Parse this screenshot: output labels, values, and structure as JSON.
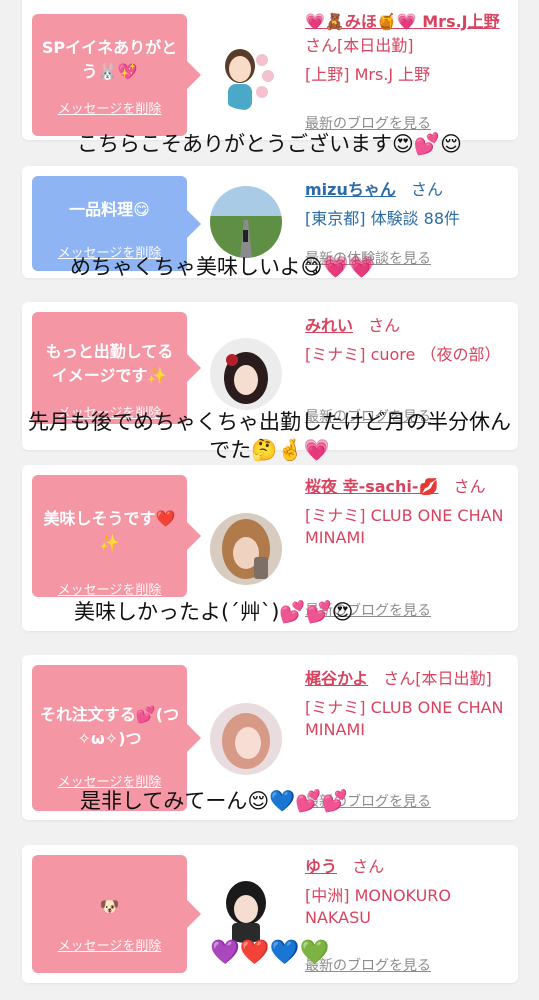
{
  "delete_label": "メッセージを削除",
  "blog_label": "最新のブログを見る",
  "cards": [
    {
      "message": "SPイイネありがとう🐰💖",
      "name": "💗🧸みほ🍯💗 Mrs.J上野",
      "san_suffix": "さん[本日出勤]",
      "shop": "[上野] Mrs.J 上野",
      "link": "最新のブログを見る",
      "overlay": "こちらこそありがとうございます😍💕😌"
    },
    {
      "message": "一品料理😋",
      "name": "mizuちゃん",
      "san_suffix": "さん",
      "shop": "[東京都] 体験談 88件",
      "link": "最新の体験談を見る",
      "overlay": "めちゃくちゃ美味しいよ😋💗💗"
    },
    {
      "message": "もっと出勤してるイメージです✨",
      "name": "みれい",
      "san_suffix": "さん",
      "shop": "[ミナミ] cuore （夜の部）",
      "link": "最新のブログを見る",
      "overlay": "先月も後でめちゃくちゃ出勤したけど月の半分休んでた🤔🤞💗"
    },
    {
      "message": "美味しそうです❤️✨",
      "name": "桜夜 幸-sachi-💋",
      "san_suffix": "さん",
      "shop": "[ミナミ] CLUB ONE CHAN MINAMI",
      "link": "最新のブログを見る",
      "overlay": "美味しかったよ(´艸`)💕💕😍"
    },
    {
      "message": "それ注文する💕(つ✧ω✧)つ",
      "name": "梶谷かよ",
      "san_suffix": "さん[本日出勤]",
      "shop": "[ミナミ] CLUB ONE CHAN MINAMI",
      "link": "最新のブログを見る",
      "overlay": "是非してみてーん😌💙💕💕"
    },
    {
      "message": "🐶",
      "name": "ゆう",
      "san_suffix": "さん",
      "shop": "[中洲] MONOKURO NAKASU",
      "link": "最新のブログを見る",
      "overlay": "💜❤️💙💚"
    }
  ],
  "colors": {
    "bubble_pink": "#f596a4",
    "bubble_blue": "#8eb4f3",
    "name_pink": "#d9435f",
    "name_blue": "#2b6ca8",
    "background": "#f1f1f1"
  }
}
